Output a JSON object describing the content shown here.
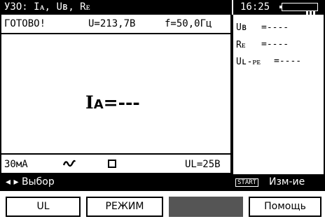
{
  "header": {
    "title": "УЗО: Iᴀ, Uʙ, Rᴇ",
    "time": "16:25",
    "battery_level": 1.0
  },
  "main": {
    "status": "ГОТОВО!",
    "voltage": "U=213,7В",
    "frequency": "f=50,0Гц",
    "result_label": "I",
    "result_sub": "A",
    "result_value": "=---",
    "current": "30мА",
    "ul": "UL=25В",
    "waveform_icon": "sine-wave-icon",
    "type_icon": "square-icon"
  },
  "side": {
    "rows": [
      {
        "label": "Uʙ",
        "value": "=----"
      },
      {
        "label": "Rᴇ",
        "value": "=----"
      },
      {
        "label": "Uʟ-ᴘᴇ",
        "value": "=----"
      }
    ]
  },
  "hint": {
    "select": "◂ ▸ Выбор",
    "start": "START",
    "change": "Изм-ие"
  },
  "softkeys": {
    "ul": "UL",
    "mode": "РЕЖИМ",
    "blank": "",
    "help": "Помощь"
  }
}
